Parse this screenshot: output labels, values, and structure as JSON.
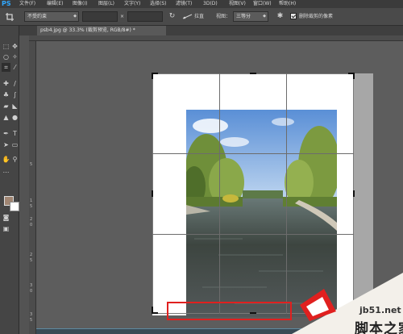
{
  "app": {
    "logo": "PS"
  },
  "menu": [
    "文件(F)",
    "编辑(E)",
    "图像(I)",
    "图层(L)",
    "文字(Y)",
    "选择(S)",
    "滤镜(T)",
    "3D(D)",
    "视图(V)",
    "窗口(W)",
    "帮助(H)"
  ],
  "options": {
    "ratio_value": "不受约束",
    "times_sign": "×",
    "straighten_label": "拉直",
    "view_label": "视图：",
    "view_value": "三等分",
    "delete_pixels_label": "删除裁剪的像素",
    "delete_pixels_checked": true
  },
  "document": {
    "tab_title": "psb4.jpg @ 33.3% (裁剪预览, RGB/8#) *",
    "tab_close": "×"
  },
  "colors": {
    "foreground": "#a08572",
    "background": "#ffffff",
    "highlight_box": "#e0201f"
  },
  "ruler_left_numbers": [
    "5",
    "1",
    "5",
    "2",
    "0",
    "2",
    "5",
    "3",
    "0",
    "3",
    "5"
  ],
  "watermark": {
    "url": "jb51.net",
    "name": "脚本之家"
  }
}
